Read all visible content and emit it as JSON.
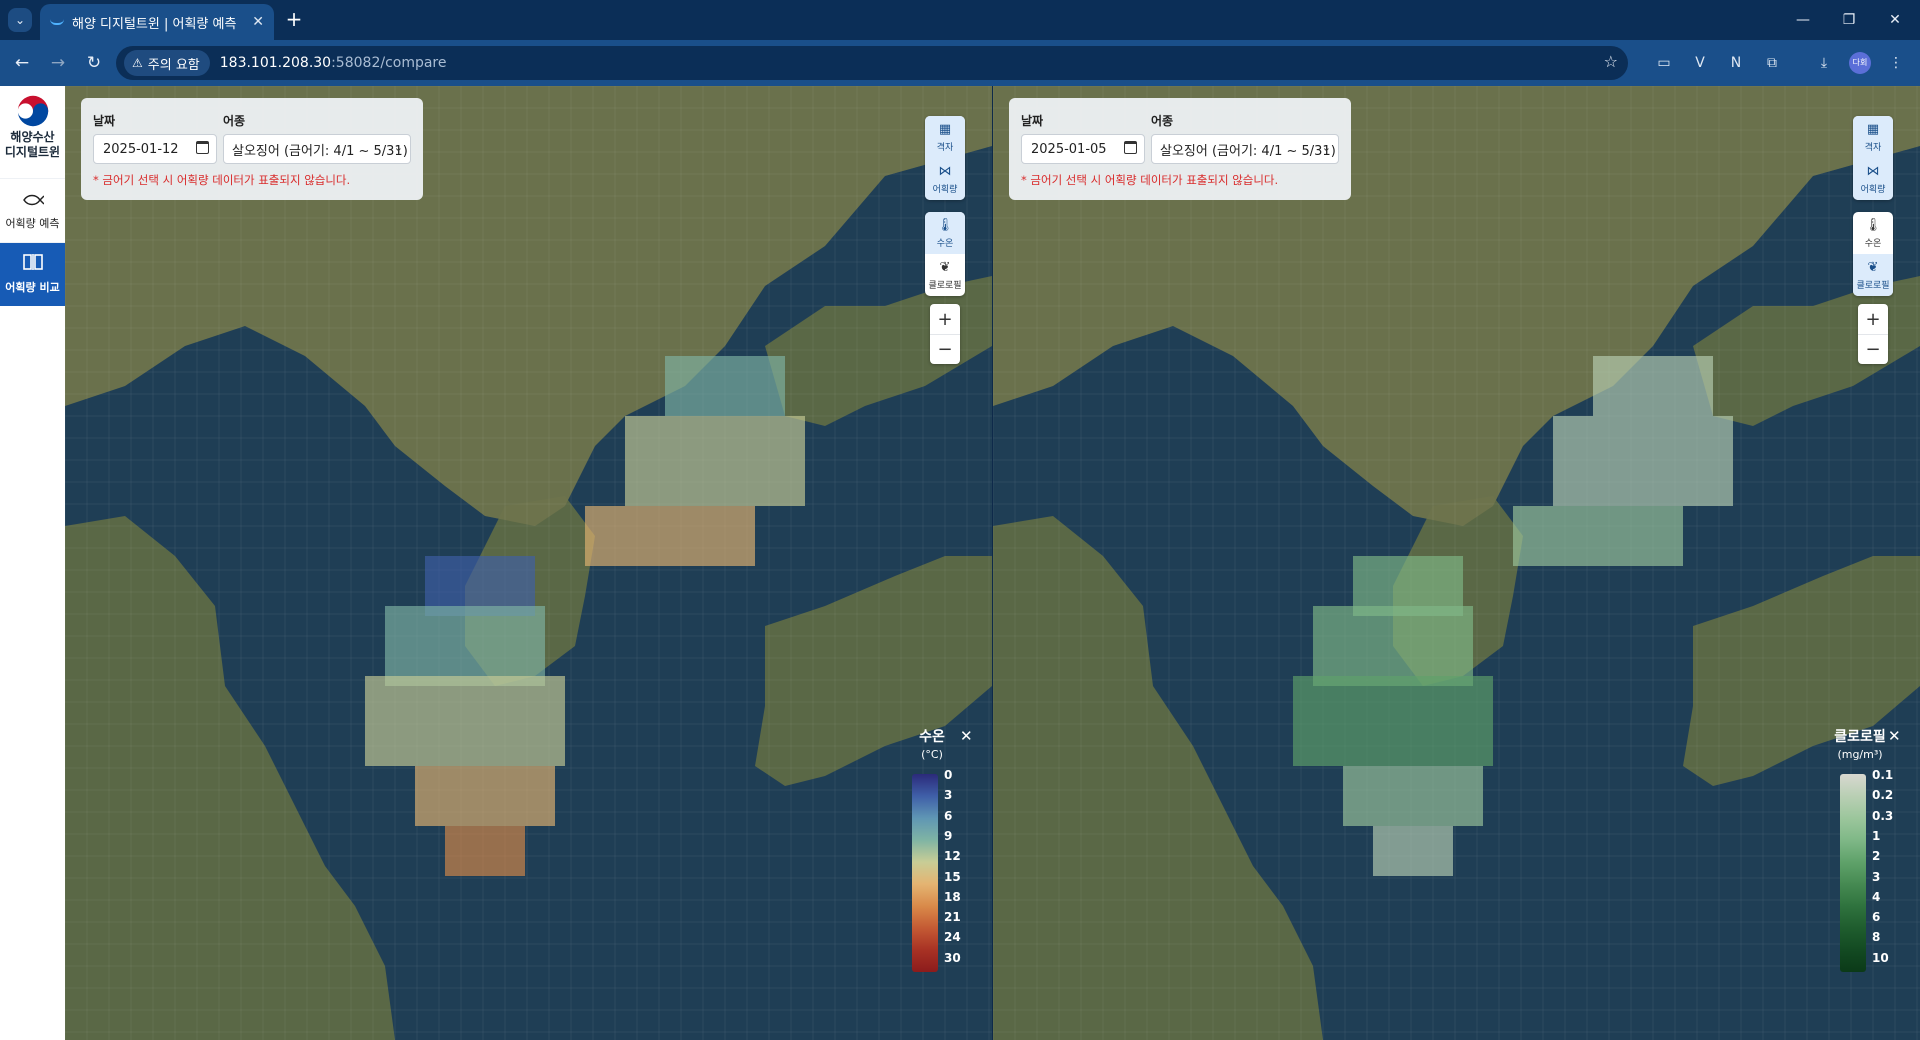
{
  "browser": {
    "tab_title": "해양 디지털트윈 | 어획량 예측",
    "security_label": "주의 요함",
    "url_host": "183.101.208.30",
    "url_rest": ":58082/compare",
    "profile_label": "다회"
  },
  "sidebar": {
    "logo_line1": "해양수산",
    "logo_line2": "디지털트윈",
    "items": [
      {
        "label": "어획량 예측",
        "icon": "fish-icon",
        "active": false
      },
      {
        "label": "어획량 비교",
        "icon": "compare-icon",
        "active": true
      }
    ]
  },
  "panels": [
    {
      "date_label": "날짜",
      "species_label": "어종",
      "date_value": "2025-01-12",
      "species_value": "살오징어 (금어기: 4/1 ~ 5/31)",
      "warning": "* 금어기 선택 시 어획량 데이터가 표출되지 않습니다.",
      "tools": {
        "grid": "격자",
        "catch": "어획량",
        "temp": "수온",
        "chlorophyll": "클로로필"
      },
      "active_layer": "temperature",
      "legend": {
        "title": "수온",
        "unit": "(°C)",
        "ticks": [
          "0",
          "3",
          "6",
          "9",
          "12",
          "15",
          "18",
          "21",
          "24",
          "30"
        ],
        "colors": [
          "#2b2a7a",
          "#3f5fa8",
          "#5f96b4",
          "#7fb4a4",
          "#c8cd96",
          "#e4b472",
          "#d98a4a",
          "#c45a34",
          "#a83224",
          "#8c1c1c"
        ]
      }
    },
    {
      "date_label": "날짜",
      "species_label": "어종",
      "date_value": "2025-01-05",
      "species_value": "살오징어 (금어기: 4/1 ~ 5/31)",
      "warning": "* 금어기 선택 시 어획량 데이터가 표출되지 않습니다.",
      "tools": {
        "grid": "격자",
        "catch": "어획량",
        "temp": "수온",
        "chlorophyll": "클로로필"
      },
      "active_layer": "chlorophyll",
      "legend": {
        "title": "클로로필",
        "unit": "(mg/m³)",
        "ticks": [
          "0.1",
          "0.2",
          "0.3",
          "1",
          "2",
          "3",
          "4",
          "6",
          "8",
          "10"
        ],
        "colors": [
          "#d8d8d0",
          "#b9cfb4",
          "#9cc69c",
          "#7fb887",
          "#5fa26a",
          "#468a52",
          "#2f733e",
          "#1f5d2e",
          "#134a22",
          "#0b3a18"
        ]
      }
    }
  ]
}
